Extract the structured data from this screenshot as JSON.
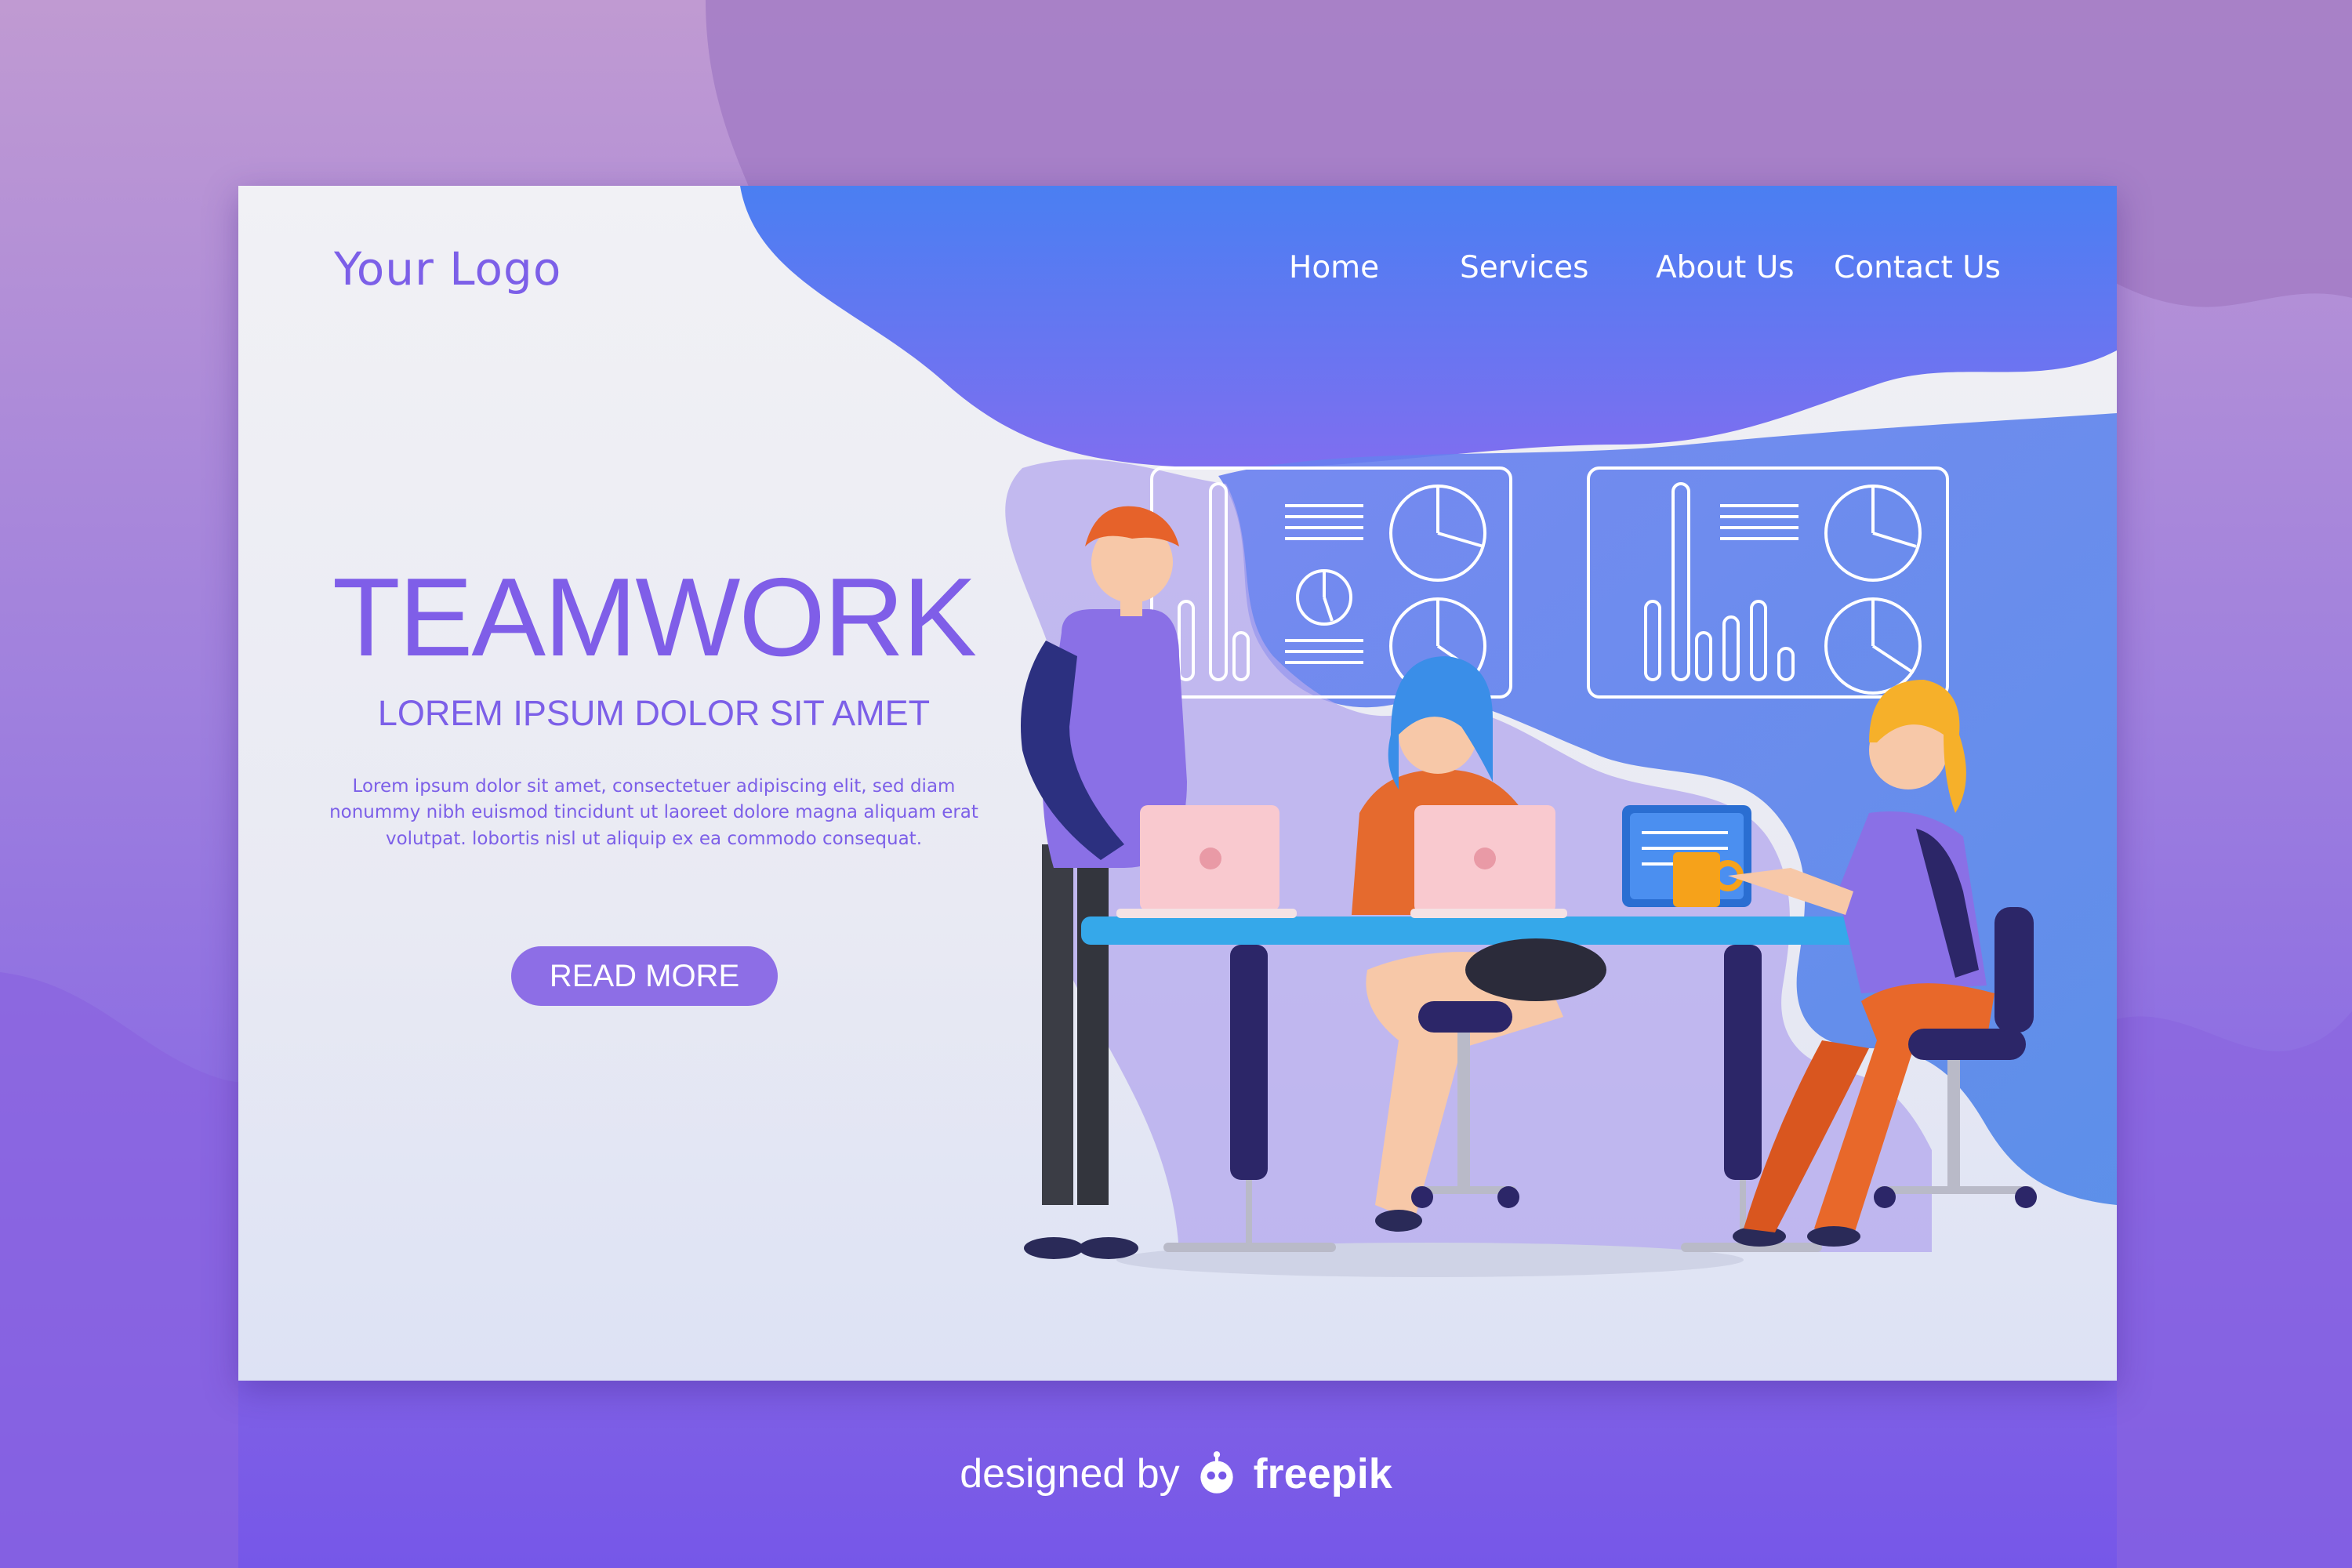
{
  "brand": {
    "logo_text": "Your Logo",
    "accent_color": "#7c5fe8"
  },
  "nav": {
    "items": [
      {
        "label": "Home"
      },
      {
        "label": "Services"
      },
      {
        "label": "About Us"
      },
      {
        "label": "Contact Us"
      }
    ]
  },
  "hero": {
    "title": "TEAMWORK",
    "subtitle": "LOREM IPSUM DOLOR SIT AMET",
    "body": "Lorem ipsum dolor sit amet, consectetuer adipiscing elit, sed diam nonummy nibh euismod tincidunt ut laoreet dolore magna aliquam erat volutpat. lobortis nisl ut aliquip ex ea commodo consequat.",
    "cta_label": "READ MORE"
  },
  "illustration": {
    "scene": "three-people-working-at-desk-with-laptops",
    "icons": [
      "dashboard-chart-icon",
      "pie-chart-icon",
      "bar-chart-icon",
      "laptop-icon",
      "coffee-mug-icon"
    ]
  },
  "footer": {
    "designed_by": "designed by",
    "brand": "freepik",
    "icon": "freepik-logo-icon"
  }
}
